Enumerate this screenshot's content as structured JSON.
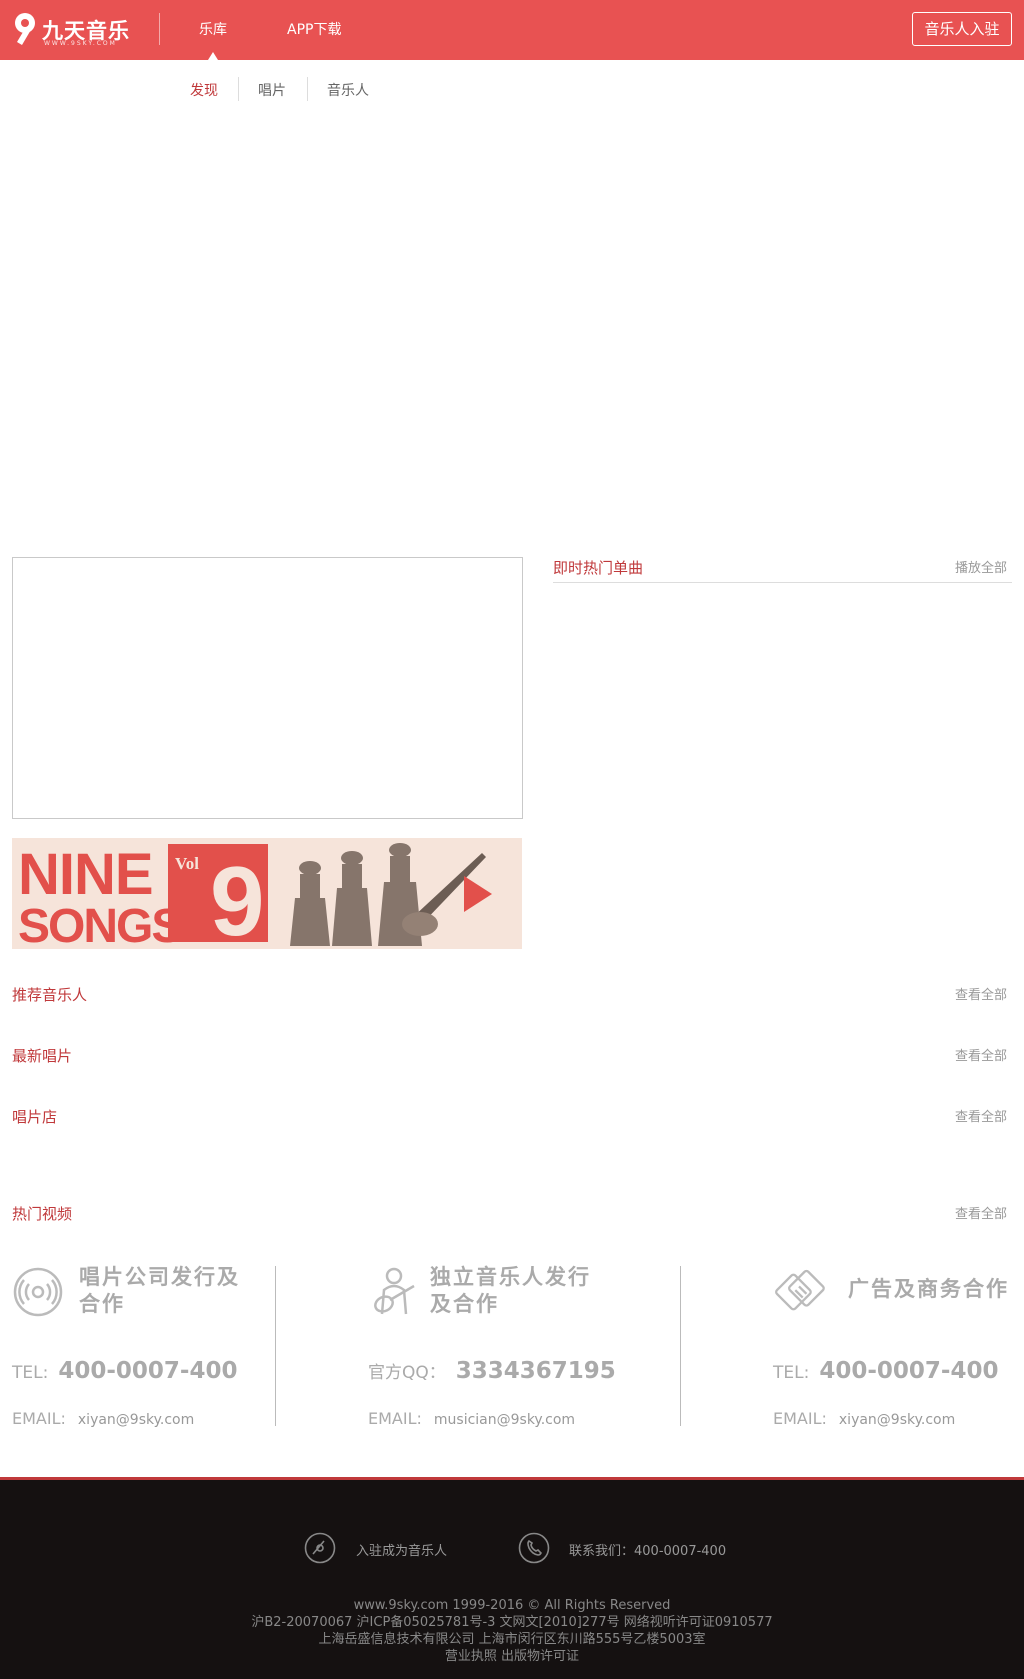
{
  "header": {
    "logo_text": "九天音乐",
    "logo_sub": "WWW.9SKY.COM",
    "nav": [
      "乐库",
      "APP下载"
    ],
    "join_button": "音乐人入驻"
  },
  "subnav": {
    "items": [
      "发现",
      "唱片",
      "音乐人"
    ],
    "active": "发现"
  },
  "hot_singles": {
    "title": "即时热门单曲",
    "link": "播放全部"
  },
  "banner": {
    "line1": "NINE",
    "line2": "SONGS",
    "vol": "Vol",
    "number": "9"
  },
  "sections": [
    {
      "title": "推荐音乐人",
      "link": "查看全部"
    },
    {
      "title": "最新唱片",
      "link": "查看全部"
    },
    {
      "title": "唱片店",
      "link": "查看全部"
    },
    {
      "title": "热门视频",
      "link": "查看全部"
    }
  ],
  "contacts": [
    {
      "title": "唱片公司发行及合作",
      "phone_label": "TEL:",
      "phone": "400-0007-400",
      "email_label": "EMAIL:",
      "email": "xiyan@9sky.com",
      "icon": "vinyl-icon"
    },
    {
      "title": "独立音乐人发行及合作",
      "phone_label": "官方QQ：",
      "phone": "3334367195",
      "email_label": "EMAIL:",
      "email": "musician@9sky.com",
      "icon": "guitarist-icon"
    },
    {
      "title": "广告及商务合作",
      "phone_label": "TEL:",
      "phone": "400-0007-400",
      "email_label": "EMAIL:",
      "email": "xiyan@9sky.com",
      "icon": "handshake-icon"
    }
  ],
  "footer": {
    "links": [
      "入驻成为音乐人",
      "联系我们：400-0007-400"
    ],
    "lines": [
      "www.9sky.com 1999-2016 © All Rights Reserved",
      "沪B2-20070067 沪ICP备05025781号-3 文网文[2010]277号 网络视听许可证0910577",
      "上海岳盛信息技术有限公司 上海市闵行区东川路555号乙楼5003室",
      "营业执照 出版物许可证"
    ]
  },
  "colors": {
    "brand": "#e85252",
    "accent_text": "#c0393b",
    "footer_bg": "#151111"
  }
}
